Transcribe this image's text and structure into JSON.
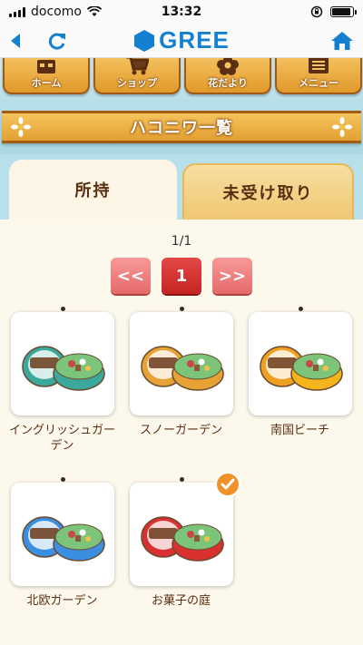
{
  "status": {
    "carrier": "docomo",
    "time": "13:32",
    "battery_level": 0.9
  },
  "navbar": {
    "logo_text": "GREE",
    "icons": [
      "back-icon",
      "reload-icon",
      "home-icon"
    ]
  },
  "menu": {
    "items": [
      {
        "label": "ホーム",
        "icon": "house-icon"
      },
      {
        "label": "ショップ",
        "icon": "cart-icon"
      },
      {
        "label": "花だより",
        "icon": "flower-icon"
      },
      {
        "label": "メニュー",
        "icon": "menu-list-icon"
      }
    ]
  },
  "page_title": "ハコニワ一覧",
  "tabs": [
    {
      "label": "所持",
      "active": true
    },
    {
      "label": "未受け取り",
      "active": false
    }
  ],
  "pagination": {
    "count": "1/1",
    "prev_label": "<<",
    "current": "1",
    "next_label": ">>"
  },
  "items": [
    {
      "name": "イングリッシュガーデン",
      "lid_color": "#3aa89a",
      "body_color": "#3aa89a",
      "checked": false
    },
    {
      "name": "スノーガーデン",
      "lid_color": "#e6a234",
      "body_color": "#e6a234",
      "checked": false
    },
    {
      "name": "南国ビーチ",
      "lid_color": "#f0a020",
      "body_color": "#f3b41c",
      "checked": false
    },
    {
      "name": "北欧ガーデン",
      "lid_color": "#3a8fe0",
      "body_color": "#3a8fe0",
      "checked": false
    },
    {
      "name": "お菓子の庭",
      "lid_color": "#d93030",
      "body_color": "#d93030",
      "checked": true
    }
  ],
  "colors": {
    "accent_blue": "#1580d0",
    "banner_orange": "#e3a032",
    "pager_red": "#e54848",
    "text_brown": "#5a2e10"
  }
}
